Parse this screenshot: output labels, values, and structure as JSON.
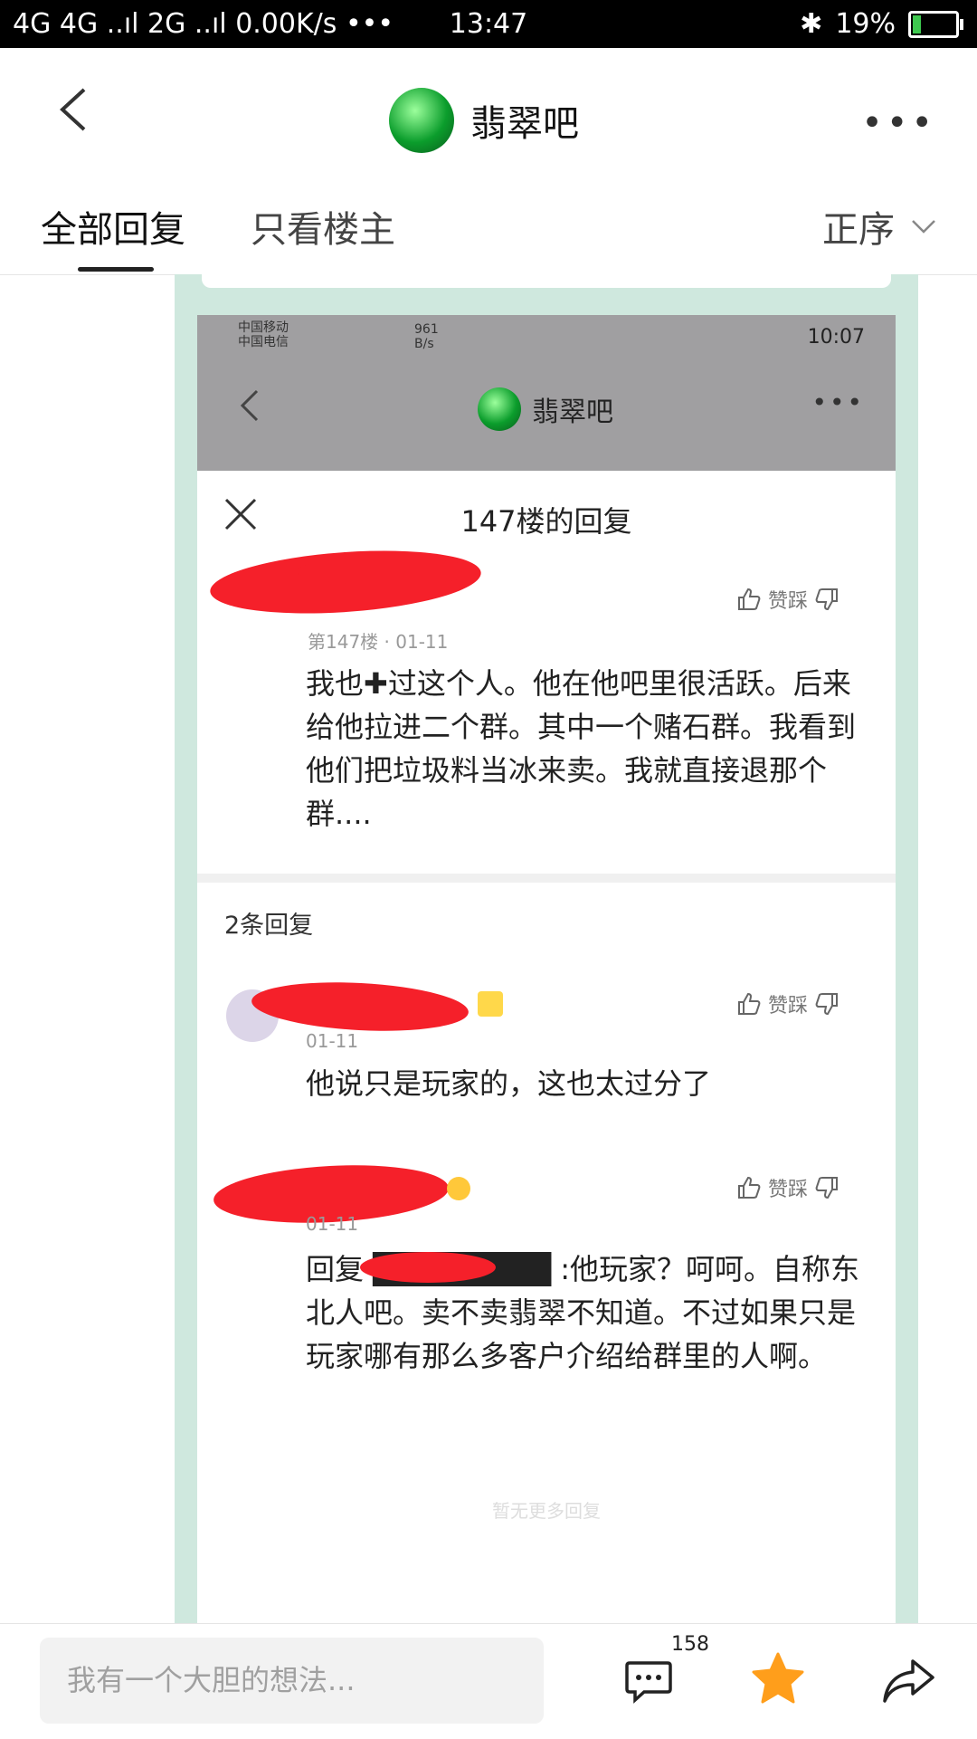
{
  "status_bar": {
    "network": "4G 4G ..ıl 2G ..ıl",
    "speed": "0.00K/s",
    "dots": "•••",
    "time": "13:47",
    "bluetooth": "✱",
    "battery": "19%",
    "battery_level": 0.19
  },
  "header": {
    "title": "翡翠吧",
    "more": "•••"
  },
  "tabs": {
    "all_replies": "全部回复",
    "only_op": "只看楼主",
    "sort": "正序"
  },
  "screenshot": {
    "status_left_line1": "中国移动",
    "status_left_line2": "中国电信",
    "status_speed": "961 B/s",
    "status_time": "10:07",
    "bar_title": "翡翠吧",
    "more": "•••",
    "dialog_title": "147楼的回复",
    "main_post": {
      "meta": "第147楼 · 01-11",
      "text": "我也✚过这个人。他在他吧里很活跃。后来给他拉进二个群。其中一个赌石群。我看到他们把垃圾料当冰来卖。我就直接退那个群...."
    },
    "reply_count": "2条回复",
    "replies": [
      {
        "meta": "01-11",
        "text": "他说只是玩家的，这也太过分了"
      },
      {
        "meta": "01-11",
        "text": "回复 ████████ :他玩家？呵呵。自称东北人吧。卖不卖翡翠不知道。不过如果只是玩家哪有那么多客户介绍给群里的人啊。"
      }
    ],
    "like_dislike": "赞踩",
    "no_more": "暂无更多回复"
  },
  "bottom_bar": {
    "input_placeholder": "我有一个大胆的想法...",
    "comment_count": "158"
  },
  "colors": {
    "redaction": "#f5202a",
    "frame": "#cfe8de",
    "star": "#ff9e1b"
  }
}
